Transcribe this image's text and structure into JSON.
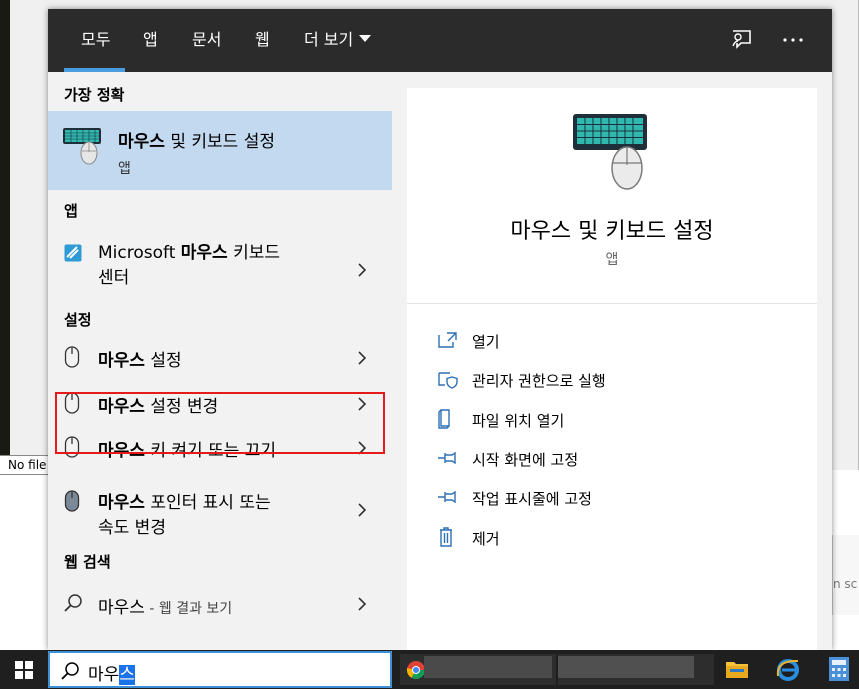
{
  "background": {
    "status_text": "No file",
    "right_clip_text": "n sc"
  },
  "header": {
    "tabs": [
      {
        "label": "모두",
        "active": true
      },
      {
        "label": "앱"
      },
      {
        "label": "문서"
      },
      {
        "label": "웹"
      },
      {
        "label": "더 보기"
      }
    ],
    "icons": [
      "feedback-icon",
      "more-options-icon"
    ]
  },
  "left": {
    "best_match_title": "가장 정확",
    "best_match": {
      "bold": "마우스",
      "rest": " 및 키보드 설정",
      "sub": "앱"
    },
    "apps_title": "앱",
    "app_item": {
      "pre": "Microsoft ",
      "bold": "마우스",
      "rest": " 키보드",
      "line2": "센터"
    },
    "settings_title": "설정",
    "settings": [
      {
        "bold": "마우스",
        "rest": " 설정"
      },
      {
        "bold": "마우스",
        "rest": " 설정 변경"
      },
      {
        "bold": "마우스",
        "rest": " 키 켜기 또는 끄기"
      },
      {
        "bold": "마우스",
        "rest": " 포인터 표시 또는",
        "line2": "속도 변경"
      }
    ],
    "web_title": "웹 검색",
    "web_item": {
      "main": "마우스",
      "sub": " - 웹 결과 보기"
    }
  },
  "right": {
    "title": "마우스 및 키보드 설정",
    "sub": "앱",
    "actions": [
      {
        "label": "열기",
        "icon": "open-icon"
      },
      {
        "label": "관리자 권한으로 실행",
        "icon": "shield-icon"
      },
      {
        "label": "파일 위치 열기",
        "icon": "file-location-icon"
      },
      {
        "label": "시작 화면에 고정",
        "icon": "pin-icon"
      },
      {
        "label": "작업 표시줄에 고정",
        "icon": "pin-icon"
      },
      {
        "label": "제거",
        "icon": "trash-icon"
      }
    ]
  },
  "taskbar": {
    "search_prefix": "마우",
    "search_selected": "스"
  },
  "colors": {
    "accent": "#4a9cdc",
    "best_match_bg": "#c3d9ef",
    "highlight_border": "#e51b1b",
    "header_bg": "#2b2b2b"
  }
}
